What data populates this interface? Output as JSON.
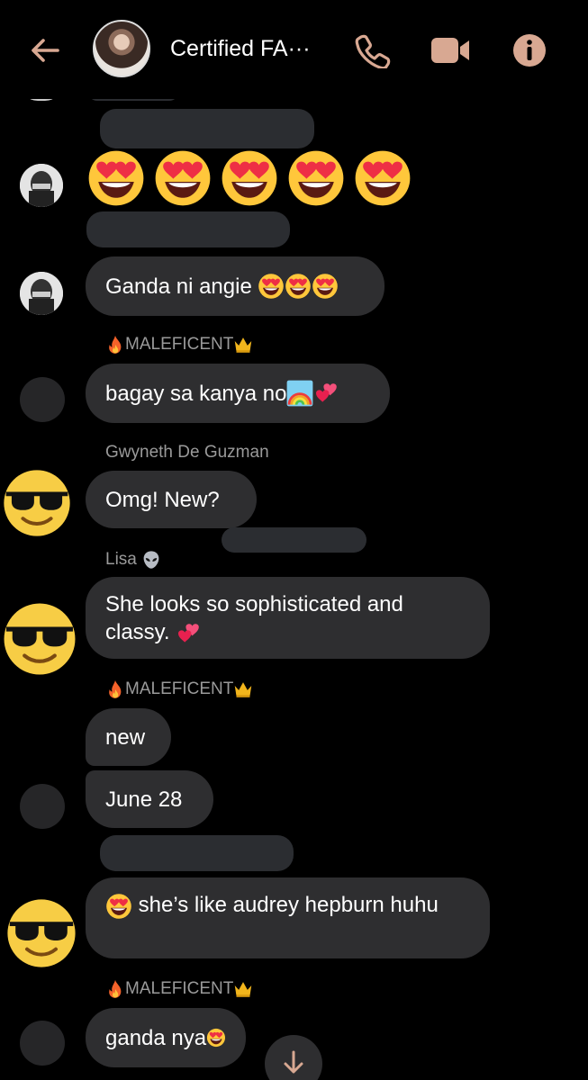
{
  "header": {
    "title": "Certified FA···",
    "icons": {
      "back": "arrow-left-icon",
      "call": "phone-icon",
      "video": "video-camera-icon",
      "info": "info-icon"
    },
    "accent": "#d8a892"
  },
  "messages": [
    {
      "text": "Ganda ni angie",
      "emoji": [
        "heart-eyes",
        "heart-eyes",
        "heart-eyes"
      ]
    },
    {
      "sender": "MALEFICENT",
      "sender_emoji": [
        "fire",
        "crown"
      ],
      "text": "bagay sa kanya no",
      "emoji": [
        "rainbow",
        "two-hearts"
      ]
    },
    {
      "sender": "Gwyneth De Guzman",
      "text": "Omg! New?"
    },
    {
      "sender": "Lisa",
      "sender_emoji": [
        "alien"
      ],
      "text": "She looks so sophisticated and classy.",
      "emoji": [
        "two-hearts"
      ]
    },
    {
      "sender": "MALEFICENT",
      "sender_emoji": [
        "fire",
        "crown"
      ],
      "text": "new"
    },
    {
      "text": "June 28"
    },
    {
      "text": "she’s like audrey hepburn huhu",
      "emoji": [
        "heart-eyes"
      ]
    },
    {
      "sender": "MALEFICENT",
      "sender_emoji": [
        "fire",
        "crown"
      ],
      "text": "ganda nya",
      "emoji": [
        "heart-eyes"
      ]
    }
  ],
  "big_emoji_count": 5,
  "colors": {
    "bubble": "#2e2e30",
    "background": "#000000",
    "sender_text": "#9a9a9a"
  }
}
